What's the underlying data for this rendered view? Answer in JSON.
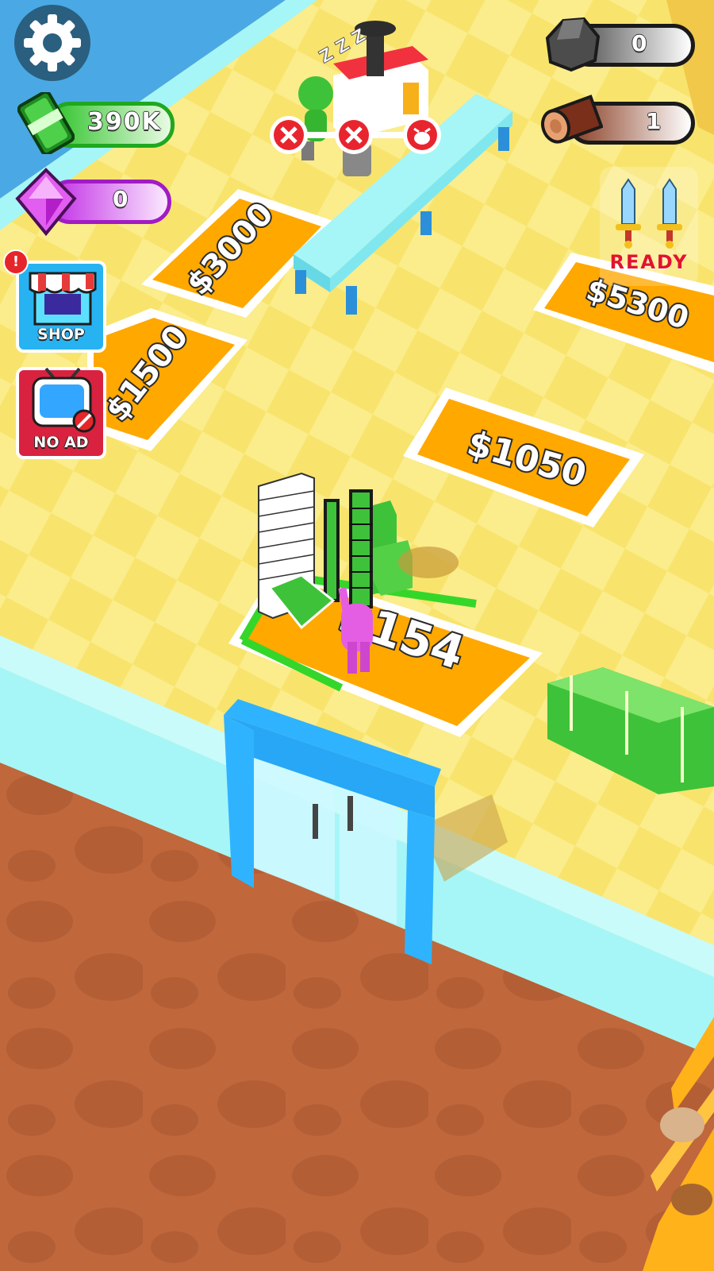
{
  "hud": {
    "cash": "390K",
    "gems": "0",
    "stone": "0",
    "wood": "1",
    "weapon_status": "READY",
    "shop_label": "SHOP",
    "no_ad_label": "NO AD",
    "notify_mark": "!",
    "sleep_marks": "Z Z Z"
  },
  "tiles": {
    "t3000": "$3000",
    "t1500": "$1500",
    "t5300": "$5300",
    "t1050": "$1050",
    "t154": "$154"
  },
  "colors": {
    "floor": "#f7e36a",
    "tile": "#ffa800",
    "ground": "#c0673c",
    "wall": "#a6f6f7",
    "water": "#4aa9e4",
    "door": "#2fb3ff",
    "cash": "#33c52f",
    "gem": "#b82ae0"
  },
  "icons": [
    "gear-icon",
    "cash-icon",
    "gem-icon",
    "stone-icon",
    "log-icon",
    "sword-icon",
    "shop-icon",
    "tv-icon"
  ]
}
